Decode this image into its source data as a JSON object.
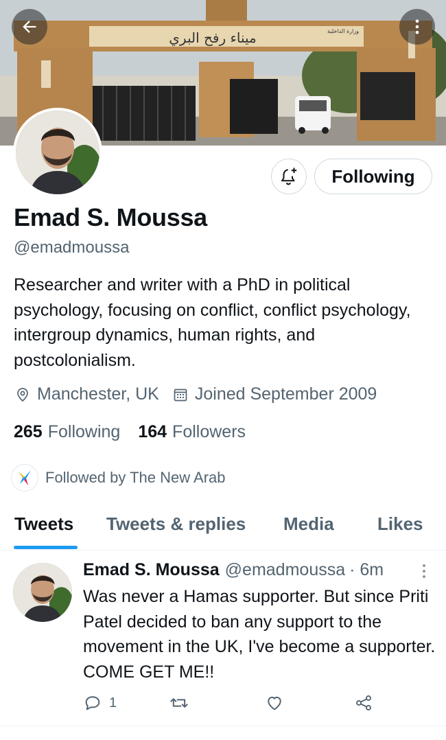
{
  "header": {
    "back_icon": "arrow-left-icon",
    "more_icon": "vertical-dots-icon",
    "banner_signs": [
      "ميناء رفح البري",
      "وزارة الداخلية"
    ]
  },
  "profile": {
    "name": "Emad S. Moussa",
    "handle": "@emadmoussa",
    "bio": "Researcher and writer with a PhD in political psychology, focusing on conflict, conflict psychology, intergroup dynamics, human rights, and postcolonialism.",
    "location": "Manchester, UK",
    "joined": "Joined September 2009",
    "following_count": "265",
    "following_label": "Following",
    "followers_count": "164",
    "followers_label": "Followers",
    "followed_by": "Followed by The New Arab",
    "follow_button_label": "Following"
  },
  "tabs": [
    {
      "label": "Tweets",
      "active": true
    },
    {
      "label": "Tweets & replies",
      "active": false
    },
    {
      "label": "Media",
      "active": false
    },
    {
      "label": "Likes",
      "active": false
    }
  ],
  "tweet": {
    "author_name": "Emad S. Moussa",
    "author_handle": "@emadmoussa",
    "time": "· 6m",
    "text": "Was never a Hamas supporter. But since Priti Patel decided to ban any support to the movement in the UK, I've become a supporter. COME GET ME!!",
    "reply_count": "1",
    "retweet_count": "",
    "like_count": ""
  },
  "colors": {
    "accent": "#1d9bf0",
    "text_primary": "#0f1419",
    "text_secondary": "#536471",
    "border": "#cfd9de"
  }
}
